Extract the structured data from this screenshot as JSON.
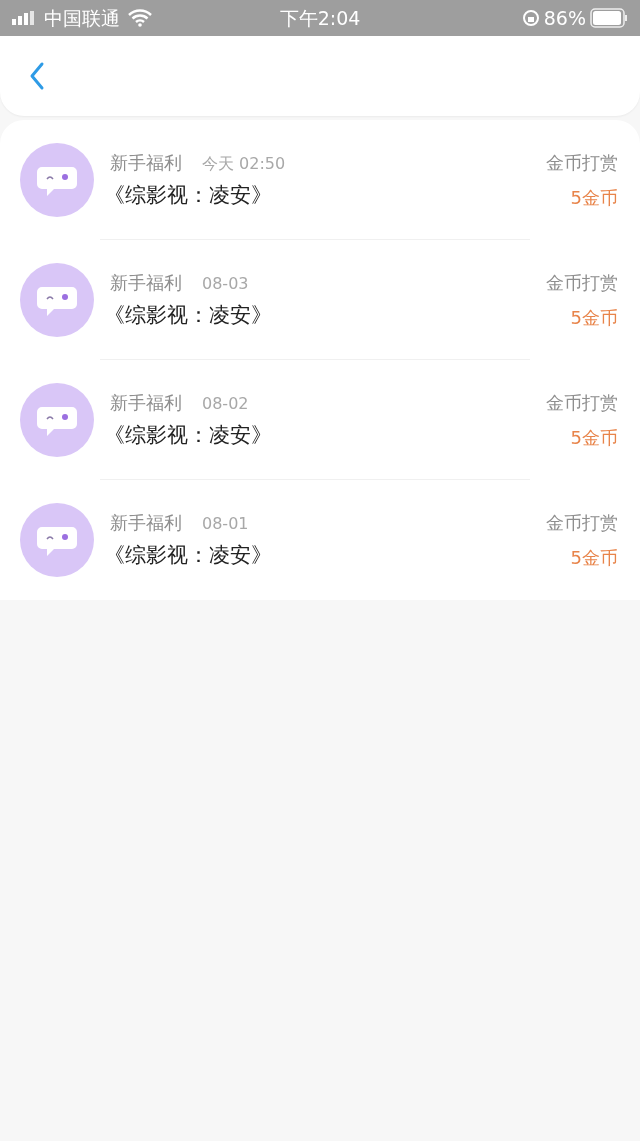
{
  "status_bar": {
    "carrier": "中国联通",
    "time": "下午2:04",
    "battery": "86%"
  },
  "records": [
    {
      "source": "新手福利",
      "date": "今天 02:50",
      "title": "《综影视：凌安》",
      "type": "金币打赏",
      "amount": "5金币"
    },
    {
      "source": "新手福利",
      "date": "08-03",
      "title": "《综影视：凌安》",
      "type": "金币打赏",
      "amount": "5金币"
    },
    {
      "source": "新手福利",
      "date": "08-02",
      "title": "《综影视：凌安》",
      "type": "金币打赏",
      "amount": "5金币"
    },
    {
      "source": "新手福利",
      "date": "08-01",
      "title": "《综影视：凌安》",
      "type": "金币打赏",
      "amount": "5金币"
    }
  ]
}
